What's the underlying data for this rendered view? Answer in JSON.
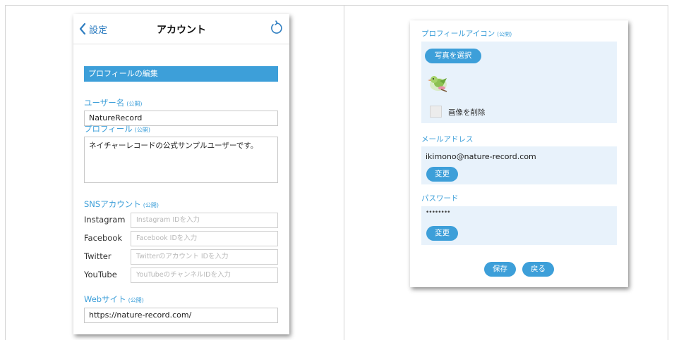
{
  "left": {
    "nav": {
      "back_label": "設定",
      "title": "アカウント"
    },
    "section_header": "プロフィールの編集",
    "public_tag": "(公開)",
    "username": {
      "label": "ユーザー名",
      "value": "NatureRecord"
    },
    "profile": {
      "label": "プロフィール",
      "value": "ネイチャーレコードの公式サンプルユーザーです。"
    },
    "sns": {
      "label": "SNSアカウント",
      "rows": [
        {
          "name": "Instagram",
          "placeholder": "Instagram IDを入力"
        },
        {
          "name": "Facebook",
          "placeholder": "Facebook IDを入力"
        },
        {
          "name": "Twitter",
          "placeholder": "Twitterのアカウント IDを入力"
        },
        {
          "name": "YouTube",
          "placeholder": "YouTubeのチャンネルIDを入力"
        }
      ]
    },
    "website": {
      "label": "Webサイト",
      "value": "https://nature-record.com/"
    }
  },
  "right": {
    "icon_section": {
      "label": "プロフィールアイコン",
      "select_button": "写真を選択",
      "delete_label": "画像を削除",
      "icon": "bird-icon"
    },
    "email": {
      "label": "メールアドレス",
      "value": "ikimono@nature-record.com",
      "change_button": "変更"
    },
    "password": {
      "label": "パスワード",
      "value": "••••••••",
      "change_button": "変更"
    },
    "save_button": "保存",
    "back_button": "戻る"
  },
  "colors": {
    "accent": "#3d9fd9",
    "link": "#2f7ec1",
    "panel": "#e8f2fb"
  }
}
